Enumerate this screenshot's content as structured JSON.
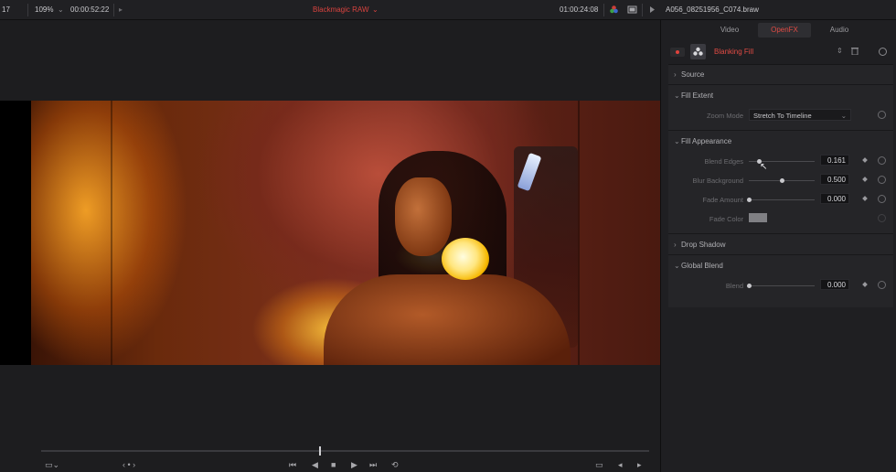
{
  "topbar": {
    "left_num": "17",
    "zoom": "109%",
    "source_timecode": "00:00:52:22",
    "clip_format": "Blackmagic RAW",
    "timeline_timecode": "01:00:24:08",
    "clip_name": "A056_08251956_C074.braw"
  },
  "inspector": {
    "tabs": [
      {
        "label": "Video",
        "active": false
      },
      {
        "label": "OpenFX",
        "active": true
      },
      {
        "label": "Audio",
        "active": false
      }
    ],
    "effect_name": "Blanking Fill",
    "sections": {
      "source": "Source",
      "fill_extent": "Fill Extent",
      "fill_appearance": "Fill Appearance",
      "drop_shadow": "Drop Shadow",
      "global_blend": "Global Blend"
    },
    "zoom_mode": {
      "label": "Zoom Mode",
      "value": "Stretch To Timeline"
    },
    "blend_edges": {
      "label": "Blend Edges",
      "value": "0.161",
      "fraction": 0.161
    },
    "blur_background": {
      "label": "Blur Background",
      "value": "0.500",
      "fraction": 0.5
    },
    "fade_amount": {
      "label": "Fade Amount",
      "value": "0.000",
      "fraction": 0.0
    },
    "fade_color": {
      "label": "Fade Color",
      "color": "#808084"
    },
    "blend": {
      "label": "Blend",
      "value": "0.000",
      "fraction": 0.0
    }
  },
  "colors": {
    "accent_red": "#e04b44",
    "panel_bg": "#252528",
    "app_bg": "#1b1b1d"
  }
}
